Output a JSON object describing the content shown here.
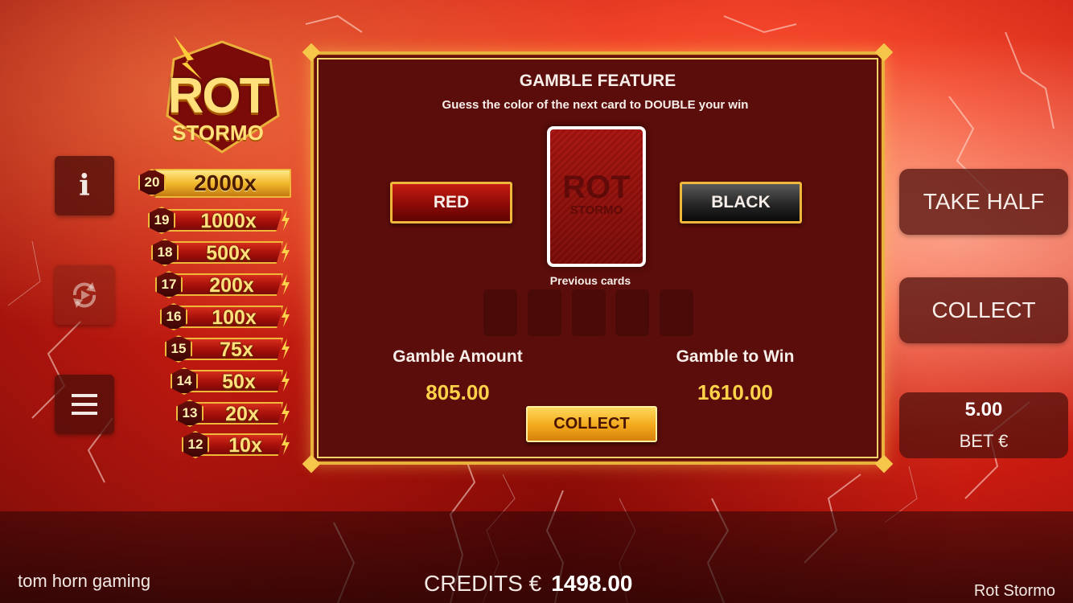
{
  "colors": {
    "dialog_bg": "#5a0d0a",
    "gold": "#f0b83a",
    "value_gold": "#ffd24a",
    "button_red": "#c51c12",
    "button_black": "#262626"
  },
  "logo": {
    "line1": "ROT",
    "line2": "STORMO"
  },
  "left_buttons": {
    "info_icon": "info-icon",
    "autoplay_icon": "autoplay-icon",
    "menu_icon": "menu-icon"
  },
  "paytable": [
    {
      "level": "20",
      "multiplier": "2000x"
    },
    {
      "level": "19",
      "multiplier": "1000x"
    },
    {
      "level": "18",
      "multiplier": "500x"
    },
    {
      "level": "17",
      "multiplier": "200x"
    },
    {
      "level": "16",
      "multiplier": "100x"
    },
    {
      "level": "15",
      "multiplier": "75x"
    },
    {
      "level": "14",
      "multiplier": "50x"
    },
    {
      "level": "13",
      "multiplier": "20x"
    },
    {
      "level": "12",
      "multiplier": "10x"
    }
  ],
  "gamble": {
    "title": "GAMBLE FEATURE",
    "subtitle": "Guess the color of the next card to DOUBLE your win",
    "red_label": "RED",
    "black_label": "BLACK",
    "card_logo_line1": "ROT",
    "card_logo_line2": "STORMO",
    "previous_cards_label": "Previous cards",
    "previous_cards": [
      "",
      "",
      "",
      "",
      ""
    ],
    "amount_label": "Gamble Amount",
    "amount_value": "805.00",
    "to_win_label": "Gamble to Win",
    "to_win_value": "1610.00",
    "collect_label": "COLLECT"
  },
  "right_panel": {
    "take_half_label": "TAKE HALF",
    "collect_label": "COLLECT",
    "bet_value": "5.00",
    "bet_label": "BET €"
  },
  "footer": {
    "brand": "tom horn gaming",
    "credits_label": "CREDITS €",
    "credits_value": "1498.00",
    "game_name": "Rot Stormo"
  }
}
